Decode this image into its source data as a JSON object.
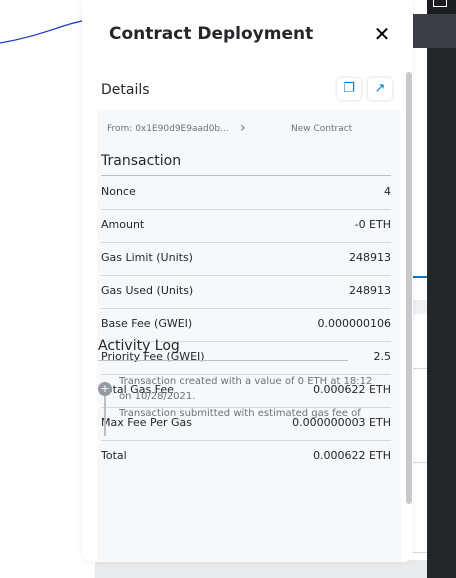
{
  "modal": {
    "title": "Contract Deployment",
    "close_icon": "close-icon"
  },
  "details": {
    "header": "Details",
    "copy_icon": "copy-icon",
    "link_icon": "external-link-icon",
    "from": "From: 0x1E90d9E9aad0b...",
    "to": "New Contract"
  },
  "transaction": {
    "title": "Transaction",
    "rows": [
      {
        "label": "Nonce",
        "value": "4"
      },
      {
        "label": "Amount",
        "value": "-0 ETH"
      },
      {
        "label": "Gas Limit (Units)",
        "value": "248913"
      },
      {
        "label": "Gas Used (Units)",
        "value": "248913"
      },
      {
        "label": "Base Fee (GWEI)",
        "value": "0.000000106"
      },
      {
        "label": "Priority Fee (GWEI)",
        "value": "2.5"
      },
      {
        "label": "Total Gas Fee",
        "value": "0.000622 ETH"
      },
      {
        "label": "Max Fee Per Gas",
        "value": "0.000000003 ETH"
      },
      {
        "label": "Total",
        "value": "0.000622 ETH"
      }
    ]
  },
  "activity_log": {
    "title": "Activity Log",
    "entries": [
      "Transaction created with a value of 0 ETH at 18:12 on 10/28/2021.",
      "Transaction submitted with estimated gas fee of"
    ]
  },
  "colors": {
    "accent": "#037dd6",
    "text": "#24272a",
    "muted": "#6a737d"
  }
}
